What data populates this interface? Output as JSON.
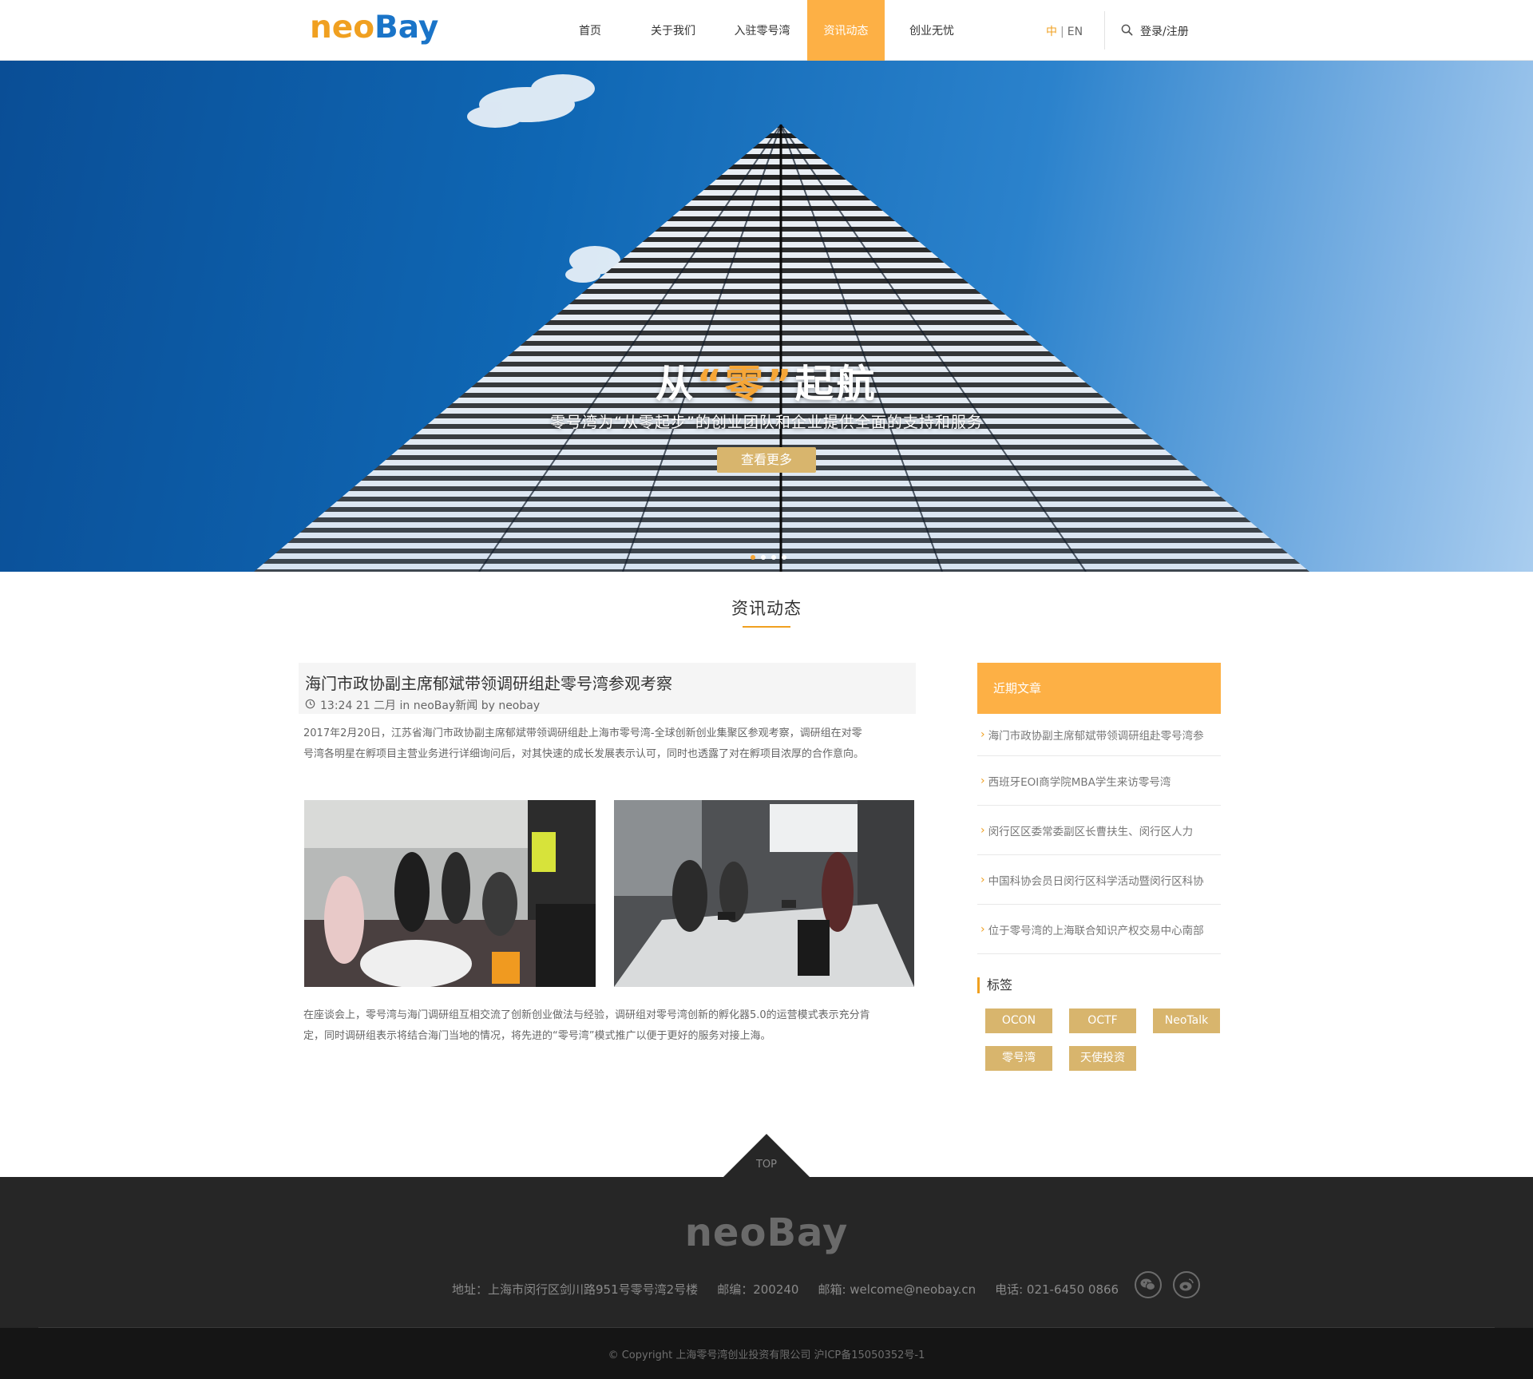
{
  "header": {
    "logo_neo": "neo",
    "logo_bay": "Bay",
    "nav": [
      "首页",
      "关于我们",
      "入驻零号湾",
      "资讯动态",
      "创业无忧"
    ],
    "nav_active": "资讯动态",
    "lang_zh": "中",
    "lang_sep": "|",
    "lang_en": "EN",
    "login": "登录/注册"
  },
  "hero": {
    "title_pre": "从",
    "title_highlight": "“零”",
    "title_post": "起航",
    "subtitle": "零号湾为“从零起步”的创业团队和企业提供全面的支持和服务",
    "button": "查看更多"
  },
  "section": {
    "title": "资讯动态"
  },
  "article": {
    "title": "海门市政协副主席郁斌带领调研组赴零号湾参观考察",
    "meta": "13:24 21 二月 in neoBay新闻 by neobay",
    "para1_line1": "2017年2月20日，江苏省海门市政协副主席郁斌带领调研组赴上海市零号湾-全球创新创业集聚区参观考察，调研组在对零",
    "para1_line2": "号湾各明星在孵项目主营业务进行详细询问后，对其快速的成长发展表示认可，同时也透露了对在孵项目浓厚的合作意向。",
    "para2_line1": "在座谈会上，零号湾与海门调研组互相交流了创新创业做法与经验，调研组对零号湾创新的孵化器5.0的运营模式表示充分肯",
    "para2_line2": "定，同时调研组表示将结合海门当地的情况，将先进的“零号湾”模式推广以便于更好的服务对接上海。"
  },
  "sidebar": {
    "recent_title": "近期文章",
    "recent": [
      "海门市政协副主席郁斌带领调研组赴零号湾参",
      "西班牙EOI商学院MBA学生来访零号湾",
      "闵行区区委常委副区长曹扶生、闵行区人力",
      "中国科协会员日闵行区科学活动暨闵行区科协",
      "位于零号湾的上海联合知识产权交易中心南部"
    ],
    "tags_title": "标签",
    "tags": [
      "OCON",
      "OCTF",
      "NeoTalk",
      "零号湾",
      "天使投资"
    ]
  },
  "footer": {
    "top_label": "TOP",
    "logo": "neoBay",
    "address": "地址：上海市闵行区剑川路951号零号湾2号楼",
    "postcode": "邮编：200240",
    "email": "邮箱: welcome@neobay.cn",
    "phone": "电话: 021-6450 0866",
    "social": [
      "wechat-icon",
      "weibo-icon"
    ],
    "copyright": "© Copyright 上海零号湾创业投资有限公司 沪ICP备15050352号-1"
  },
  "colors": {
    "accent": "#fdb045",
    "tag": "#d8b56d",
    "brand_blue": "#1a74c8",
    "footer_bg": "#262626"
  }
}
